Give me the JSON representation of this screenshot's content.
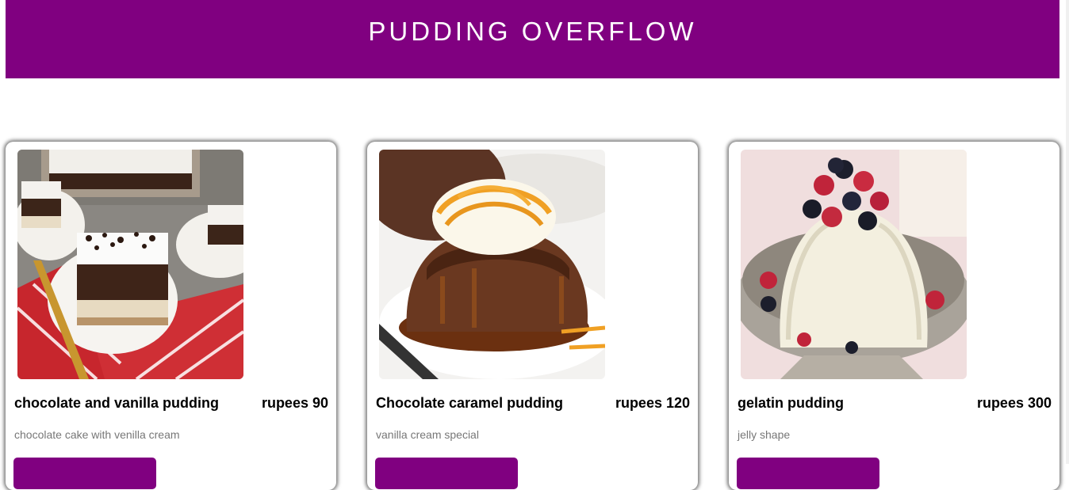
{
  "header": {
    "title": "PUDDING OVERFLOW"
  },
  "colors": {
    "brand": "#800080",
    "description": "#777777"
  },
  "cards": [
    {
      "name": "chocolate and vanilla pudding",
      "price": "rupees 90",
      "description": "chocolate cake with venilla cream"
    },
    {
      "name": "Chocolate caramel pudding",
      "price": "rupees 120",
      "description": "vanilla cream special"
    },
    {
      "name": "gelatin pudding",
      "price": "rupees 300",
      "description": "jelly shape"
    }
  ]
}
